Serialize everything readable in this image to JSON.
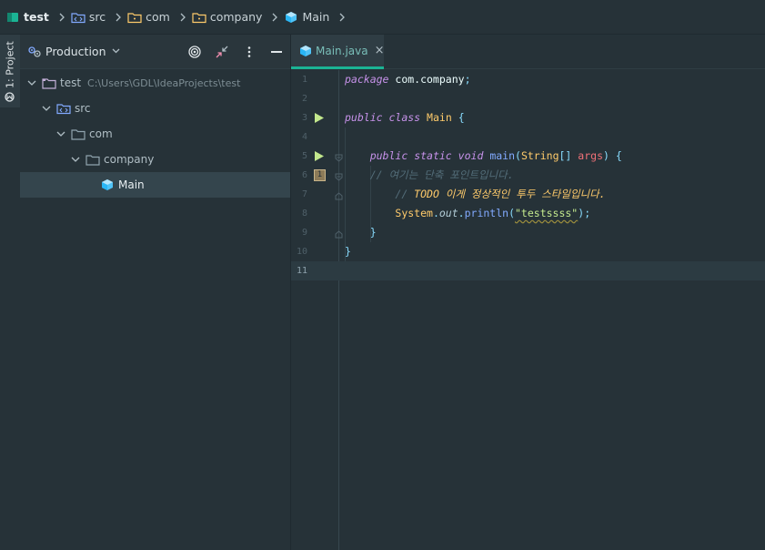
{
  "breadcrumb": {
    "items": [
      {
        "label": "test",
        "icon": "project-folder-icon"
      },
      {
        "label": "src",
        "icon": "source-folder-icon"
      },
      {
        "label": "com",
        "icon": "package-folder-icon"
      },
      {
        "label": "company",
        "icon": "package-folder-icon"
      },
      {
        "label": "Main",
        "icon": "java-class-icon"
      }
    ]
  },
  "toolstrip": {
    "project_tab_label": "1: Project"
  },
  "project_panel": {
    "view_mode": "Production",
    "tree": [
      {
        "label": "test",
        "path": "C:\\Users\\GDL\\IdeaProjects\\test",
        "icon": "module-folder-icon",
        "expanded": true,
        "depth": 0
      },
      {
        "label": "src",
        "icon": "source-folder-icon",
        "expanded": true,
        "depth": 1
      },
      {
        "label": "com",
        "icon": "folder-icon",
        "expanded": true,
        "depth": 2
      },
      {
        "label": "company",
        "icon": "folder-icon",
        "expanded": true,
        "depth": 3
      },
      {
        "label": "Main",
        "icon": "java-class-icon",
        "selected": true,
        "depth": 4
      }
    ]
  },
  "editor": {
    "tab": {
      "label": "Main.java",
      "close": "×"
    },
    "current_line": 11,
    "lines": [
      {
        "n": "1"
      },
      {
        "n": "2"
      },
      {
        "n": "3"
      },
      {
        "n": "4"
      },
      {
        "n": "5"
      },
      {
        "n": "6"
      },
      {
        "n": "7"
      },
      {
        "n": "8"
      },
      {
        "n": "9"
      },
      {
        "n": "10"
      },
      {
        "n": "11"
      }
    ],
    "code": {
      "l1_kw": "package",
      "l1_rest": " com.company",
      "l1_semi": ";",
      "l3_kw1": "public",
      "l3_kw2": "class",
      "l3_name": "Main",
      "l3_brace": "{",
      "l5_kw1": "public",
      "l5_kw2": "static",
      "l5_kw3": "void",
      "l5_fn": "main",
      "l5_open": "(",
      "l5_type": "String",
      "l5_arr": "[]",
      "l5_param": "args",
      "l5_close": ")",
      "l5_brace": "{",
      "l6_comment": "// 여기는 단축 포인트입니다.",
      "l7_comment_prefix": "// ",
      "l7_todo": "TODO 이게 정상적인 투두 스타일입니다.",
      "l8_obj": "System",
      "l8_dot1": ".",
      "l8_field": "out",
      "l8_dot2": ".",
      "l8_fn": "println",
      "l8_open": "(",
      "l8_str": "\"testssss\"",
      "l8_close": ")",
      "l8_semi": ";",
      "l9_brace": "}",
      "l10_brace": "}"
    },
    "bookmark_label": "1"
  },
  "colors": {
    "background": "#263238",
    "accent": "#1bb394",
    "keyword": "#c792ea",
    "class": "#ffcb6b",
    "function": "#82aaff",
    "string": "#c3e88d",
    "comment": "#546e7a"
  }
}
